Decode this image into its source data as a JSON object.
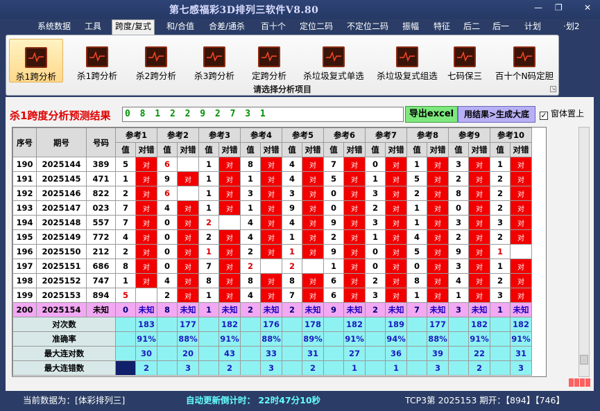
{
  "app": {
    "title": "第七感福彩3D排列三软件V8.80",
    "win_min": "—",
    "win_restore": "❐",
    "win_close": "✕"
  },
  "menu": {
    "items": [
      "系统数据",
      "工具",
      "跨度/复式",
      "和/合值",
      "合差/通杀",
      "百十个",
      "定位二码",
      "不定位二码",
      "振幅",
      "特征",
      "后二",
      "后一",
      "计划",
      "·划2"
    ],
    "active_index": 2
  },
  "ribbon": {
    "buttons": [
      "杀1跨分析",
      "杀1跨分析",
      "杀2跨分析",
      "杀3跨分析",
      "定跨分析",
      "杀垃圾复式单选",
      "杀垃圾复式组选",
      "七码保三",
      "百十个N码定胆"
    ],
    "active_index": 0,
    "caption": "请选择分析项目",
    "icon": "chart-line-icon"
  },
  "result": {
    "label": "杀1跨度分析预测结果",
    "value": "0 8 1 2 2 9 2 7 3 1",
    "excel_button": "导出excel",
    "generate_button": "用结果>生成大底",
    "topmost_label": "窗体置上",
    "topmost_checked": "✓"
  },
  "table": {
    "headers": {
      "seq": "序号",
      "issue": "期号",
      "number": "号码",
      "refs": [
        "参考1",
        "参考2",
        "参考3",
        "参考4",
        "参考5",
        "参考6",
        "参考7",
        "参考8",
        "参考9",
        "参考10"
      ],
      "val": "值",
      "correct": "对错"
    },
    "dui": "对",
    "rows": [
      {
        "seq": "190",
        "issue": "2025144",
        "number": "389",
        "vals": [
          "5",
          "6",
          "1",
          "8",
          "4",
          "7",
          "0",
          "1",
          "3",
          "1"
        ],
        "hit": [
          1,
          0,
          1,
          1,
          1,
          1,
          1,
          1,
          1,
          1
        ],
        "red": [
          0,
          1,
          0,
          0,
          0,
          0,
          0,
          0,
          0,
          0
        ]
      },
      {
        "seq": "191",
        "issue": "2025145",
        "number": "471",
        "vals": [
          "1",
          "9",
          "1",
          "1",
          "4",
          "5",
          "1",
          "5",
          "2",
          "2"
        ],
        "hit": [
          1,
          1,
          1,
          1,
          1,
          1,
          1,
          1,
          1,
          1
        ],
        "red": [
          0,
          0,
          0,
          0,
          0,
          0,
          0,
          0,
          0,
          0
        ]
      },
      {
        "seq": "192",
        "issue": "2025146",
        "number": "822",
        "vals": [
          "2",
          "6",
          "1",
          "3",
          "3",
          "0",
          "3",
          "2",
          "8",
          "2"
        ],
        "hit": [
          1,
          0,
          1,
          1,
          1,
          1,
          1,
          1,
          1,
          1
        ],
        "red": [
          0,
          1,
          0,
          0,
          0,
          0,
          0,
          0,
          0,
          0
        ]
      },
      {
        "seq": "193",
        "issue": "2025147",
        "number": "023",
        "vals": [
          "7",
          "4",
          "1",
          "1",
          "9",
          "0",
          "2",
          "1",
          "0",
          "2"
        ],
        "hit": [
          1,
          1,
          1,
          1,
          1,
          1,
          1,
          1,
          1,
          1
        ],
        "red": [
          0,
          0,
          0,
          0,
          0,
          0,
          0,
          0,
          0,
          0
        ]
      },
      {
        "seq": "194",
        "issue": "2025148",
        "number": "557",
        "vals": [
          "7",
          "0",
          "2",
          "4",
          "4",
          "9",
          "3",
          "1",
          "3",
          "3"
        ],
        "hit": [
          1,
          1,
          0,
          1,
          1,
          1,
          1,
          1,
          1,
          1
        ],
        "red": [
          0,
          0,
          1,
          0,
          0,
          0,
          0,
          0,
          0,
          0
        ]
      },
      {
        "seq": "195",
        "issue": "2025149",
        "number": "772",
        "vals": [
          "4",
          "0",
          "2",
          "4",
          "1",
          "2",
          "1",
          "4",
          "2",
          "2"
        ],
        "hit": [
          1,
          1,
          1,
          1,
          1,
          1,
          1,
          1,
          1,
          1
        ],
        "red": [
          0,
          0,
          0,
          0,
          0,
          0,
          0,
          0,
          0,
          0
        ]
      },
      {
        "seq": "196",
        "issue": "2025150",
        "number": "212",
        "vals": [
          "2",
          "0",
          "1",
          "2",
          "1",
          "9",
          "0",
          "5",
          "9",
          "1"
        ],
        "hit": [
          1,
          1,
          1,
          1,
          1,
          1,
          1,
          1,
          1,
          0
        ],
        "red": [
          0,
          0,
          1,
          0,
          1,
          0,
          0,
          0,
          0,
          1
        ]
      },
      {
        "seq": "197",
        "issue": "2025151",
        "number": "686",
        "vals": [
          "8",
          "0",
          "7",
          "2",
          "2",
          "1",
          "0",
          "0",
          "3",
          "1"
        ],
        "hit": [
          1,
          1,
          1,
          0,
          0,
          1,
          1,
          1,
          1,
          1
        ],
        "red": [
          0,
          0,
          0,
          1,
          1,
          0,
          0,
          0,
          0,
          0
        ]
      },
      {
        "seq": "198",
        "issue": "2025152",
        "number": "747",
        "vals": [
          "1",
          "4",
          "8",
          "8",
          "8",
          "6",
          "2",
          "8",
          "4",
          "2"
        ],
        "hit": [
          1,
          1,
          1,
          1,
          1,
          1,
          1,
          1,
          1,
          1
        ],
        "red": [
          0,
          0,
          0,
          0,
          0,
          0,
          0,
          0,
          0,
          0
        ]
      },
      {
        "seq": "199",
        "issue": "2025153",
        "number": "894",
        "vals": [
          "5",
          "2",
          "1",
          "4",
          "7",
          "6",
          "3",
          "1",
          "1",
          "3"
        ],
        "hit": [
          0,
          1,
          1,
          1,
          1,
          1,
          1,
          1,
          1,
          1
        ],
        "red": [
          1,
          0,
          0,
          0,
          0,
          0,
          0,
          0,
          0,
          0
        ]
      }
    ],
    "pending": {
      "seq": "200",
      "issue": "2025154",
      "number": "未知",
      "vals": [
        "0",
        "8",
        "1",
        "2",
        "2",
        "9",
        "2",
        "7",
        "3",
        "1"
      ],
      "unknown": "未知"
    },
    "stats": [
      {
        "label": "对次数",
        "values": [
          "183",
          "177",
          "182",
          "176",
          "178",
          "182",
          "189",
          "177",
          "182",
          "182"
        ]
      },
      {
        "label": "准确率",
        "values": [
          "91%",
          "88%",
          "91%",
          "88%",
          "89%",
          "91%",
          "94%",
          "88%",
          "91%",
          "91%"
        ]
      },
      {
        "label": "最大连对数",
        "values": [
          "30",
          "20",
          "43",
          "33",
          "31",
          "27",
          "36",
          "39",
          "22",
          "31"
        ]
      },
      {
        "label": "最大连错数",
        "values": [
          "2",
          "3",
          "2",
          "3",
          "2",
          "1",
          "1",
          "3",
          "2",
          "3"
        ]
      }
    ]
  },
  "status": {
    "source": "当前数据为：[体彩排列三]",
    "timer": "自动更新倒计时： 22时47分10秒",
    "draw": "TCP3第 2025153 期开：【894】【746】"
  }
}
